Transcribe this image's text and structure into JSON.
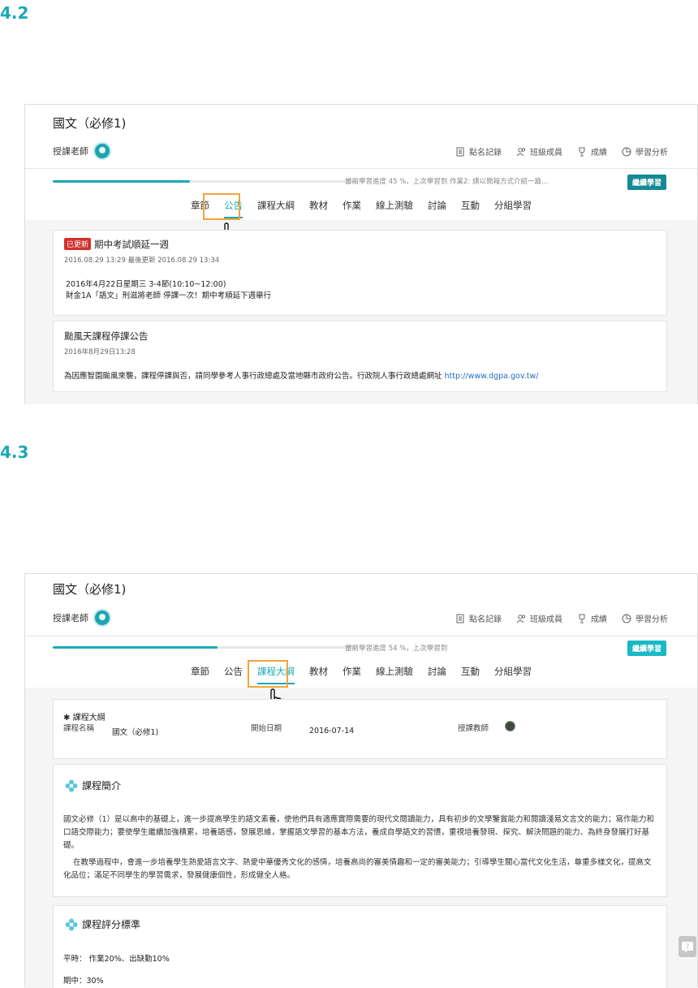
{
  "s1": {
    "label": "4.2",
    "course_title": "國文（必修1)",
    "teacher_label": "授課老師",
    "tools": [
      "點名記錄",
      "班級成員",
      "成績",
      "學習分析"
    ],
    "progress": {
      "percent": 45,
      "text": "當前學習進度 45 %，上次學習到 作業2: 請以簡報方式介紹一篇..."
    },
    "continue_btn": "繼續學習",
    "tabs": [
      "章節",
      "公告",
      "課程大綱",
      "教材",
      "作業",
      "線上測驗",
      "討論",
      "互動",
      "分組學習"
    ],
    "active_tab": "公告",
    "posts": [
      {
        "badge": "已更新",
        "title": "期中考試順延一週",
        "meta": "2016.08.29 13:29 最後更新 2016.08.29 13:34",
        "body1": "2016年4月22日星期三 3-4節(10:10~12:00)",
        "body2": "財金1A「語文」刑滋將老師 停課一次！期中考順延下週舉行"
      },
      {
        "title": "颱風天課程停課公告",
        "meta": "2016年8月29日13:28",
        "body1": "為因應智園颱風來襲，課程停課與否，請同學參考人事行政總處及當地縣市政府公告。行政院人事行政總處網址 ",
        "link": "http://www.dgpa.gov.tw/"
      }
    ]
  },
  "s2": {
    "label": "4.3",
    "course_title": "國文（必修1)",
    "teacher_label": "授課老師",
    "tools": [
      "點名記錄",
      "班級成員",
      "成績",
      "學習分析"
    ],
    "progress": {
      "percent": 54,
      "text": "當前學習進度 54 %，上次學習到"
    },
    "continue_btn": "繼續學習",
    "tabs": [
      "章節",
      "公告",
      "課程大綱",
      "教材",
      "作業",
      "線上測驗",
      "討論",
      "互動",
      "分組學習"
    ],
    "active_tab": "課程大綱",
    "syllabus": {
      "heading": "課程大綱",
      "name_label": "課程名稱",
      "name_value": "國文（必修1)",
      "date_label": "開始日期",
      "date_value": "2016-07-14",
      "teacher_label": "授課教師"
    },
    "intro_title": "課程簡介",
    "intro_p1": "國文必修（1）是以高中的基礎上，進一步提高學生的語文素養，使他們具有適應實際需要的現代文閱讀能力，具有初步的文學鑒賞能力和閱讀淺易文言文的能力；寫作能力和口語交際能力；要使學生繼續加強積累，培養語感，發展思維，掌握語文學習的基本方法，養成自學語文的習慣，重視培養發現、探究、解決問題的能力、為終身發展打好基礎。",
    "intro_p2": "在教學過程中，會進一步培養學生熱愛語言文字、熱愛中華優秀文化的感情，培養高尚的審美情趣和一定的審美能力；引導學生關心當代文化生活，尊重多樣文化，提高文化品位；滿足不同學生的學習需求，發展健康個性，形成健全人格。",
    "grading_title": "課程評分標準",
    "grading_1": "平時： 作業20%、出缺勤10%",
    "grading_2": "期中：30%"
  }
}
